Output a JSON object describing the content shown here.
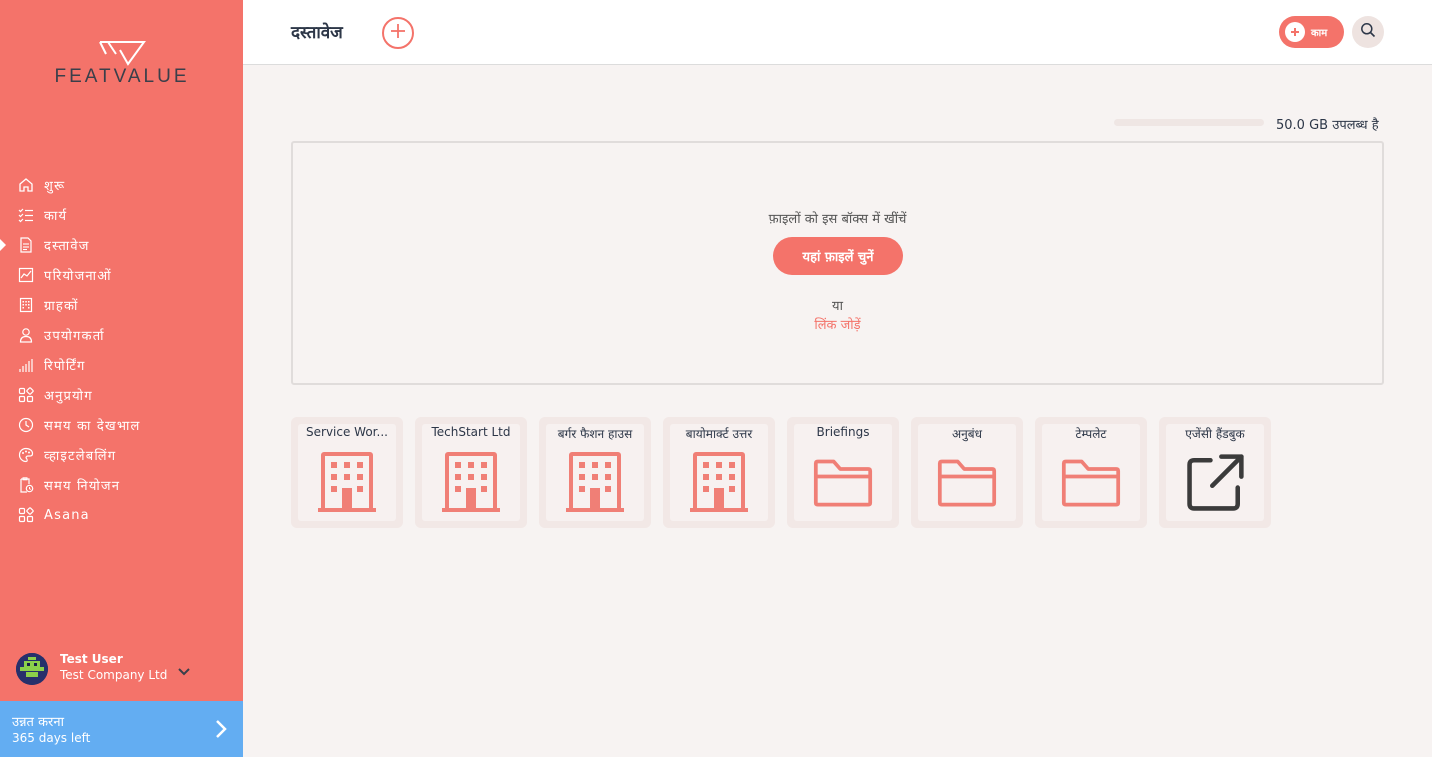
{
  "brand": {
    "logo_text": "FEATVALUE"
  },
  "colors": {
    "accent": "#f4736a",
    "upgrade": "#63adf2",
    "dark": "#2d3748",
    "icon_dark": "#3b3b3b"
  },
  "sidebar": {
    "items": [
      {
        "label": "शुरू",
        "icon": "home-icon"
      },
      {
        "label": "कार्य",
        "icon": "checklist-icon"
      },
      {
        "label": "दस्तावेज",
        "icon": "document-icon",
        "active": true
      },
      {
        "label": "परियोजनाओं",
        "icon": "chart-icon"
      },
      {
        "label": "ग्राहकों",
        "icon": "building-icon"
      },
      {
        "label": "उपयोगकर्ता",
        "icon": "user-icon"
      },
      {
        "label": "रिपोर्टिंग",
        "icon": "bar-chart-icon"
      },
      {
        "label": "अनुप्रयोग",
        "icon": "apps-icon"
      },
      {
        "label": "समय का देखभाल",
        "icon": "clock-icon"
      },
      {
        "label": "व्हाइटलेबलिंग",
        "icon": "palette-icon"
      },
      {
        "label": "समय नियोजन",
        "icon": "schedule-icon"
      },
      {
        "label": "Asana",
        "icon": "apps-icon"
      }
    ],
    "user": {
      "name": "Test User",
      "company": "Test Company Ltd"
    },
    "upgrade": {
      "title": "उन्नत करना",
      "subtitle": "365 days left"
    }
  },
  "header": {
    "title": "दस्तावेज",
    "task_label": "काम"
  },
  "storage": {
    "text": "50.0 GB उपलब्ध है",
    "used_fraction": 0.0
  },
  "dropzone": {
    "drag_text": "फ़ाइलों को इस बॉक्स में खींचें",
    "choose_label": "यहां फ़ाइलें चुनें",
    "or_text": "या",
    "link_text": "लिंक जोड़ें"
  },
  "folders": [
    {
      "label": "Service Wor...",
      "icon": "building-icon"
    },
    {
      "label": "TechStart Ltd",
      "icon": "building-icon"
    },
    {
      "label": "बर्गर फैशन हाउस",
      "icon": "building-icon"
    },
    {
      "label": "बायोमार्क्ट उत्तर",
      "icon": "building-icon"
    },
    {
      "label": "Briefings",
      "icon": "folder-icon"
    },
    {
      "label": "अनुबंध",
      "icon": "folder-icon"
    },
    {
      "label": "टेम्पलेट",
      "icon": "folder-icon"
    },
    {
      "label": "एजेंसी हैंडबुक",
      "icon": "external-link-icon"
    }
  ]
}
